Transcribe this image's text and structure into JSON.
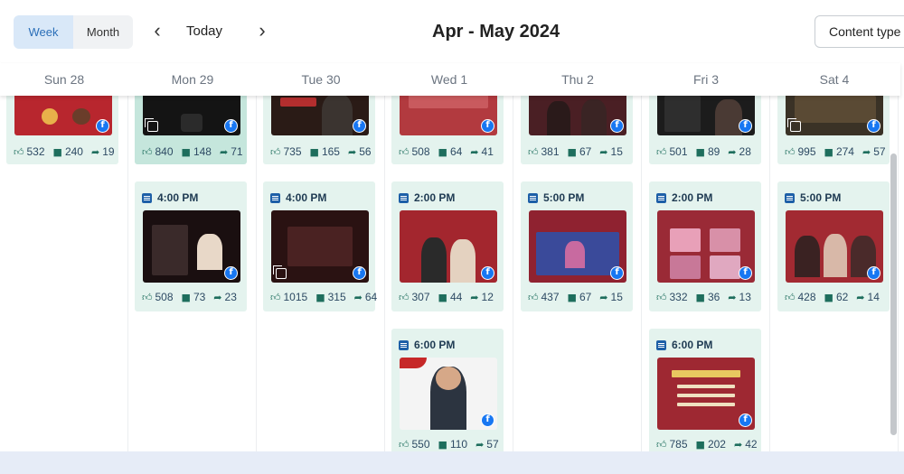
{
  "toolbar": {
    "view_week": "Week",
    "view_month": "Month",
    "today": "Today",
    "title": "Apr - May 2024",
    "content_type": "Content type",
    "prev_icon": "chevron-left-icon",
    "next_icon": "chevron-right-icon"
  },
  "days": [
    "Sun 28",
    "Mon 29",
    "Tue 30",
    "Wed 1",
    "Thu 2",
    "Fri 3",
    "Sat 4"
  ],
  "colors": {
    "accent": "#2b6fb8",
    "card": "#e4f3ee",
    "card_selected": "#c5e6dc",
    "facebook": "#1877f2"
  },
  "top_cards": [
    {
      "likes": "532",
      "comments": "240",
      "shares": "19"
    },
    {
      "likes": "840",
      "comments": "148",
      "shares": "71"
    },
    {
      "likes": "735",
      "comments": "165",
      "shares": "56"
    },
    {
      "likes": "508",
      "comments": "64",
      "shares": "41"
    },
    {
      "likes": "381",
      "comments": "67",
      "shares": "15"
    },
    {
      "likes": "501",
      "comments": "89",
      "shares": "28"
    },
    {
      "likes": "995",
      "comments": "274",
      "shares": "57"
    }
  ],
  "mid_cards": [
    {
      "time": "4:00 PM",
      "likes": "508",
      "comments": "73",
      "shares": "23"
    },
    {
      "time": "4:00 PM",
      "likes": "1015",
      "comments": "315",
      "shares": "64"
    },
    {
      "time": "2:00 PM",
      "likes": "307",
      "comments": "44",
      "shares": "12"
    },
    {
      "time": "5:00 PM",
      "likes": "437",
      "comments": "67",
      "shares": "15"
    },
    {
      "time": "2:00 PM",
      "likes": "332",
      "comments": "36",
      "shares": "13"
    },
    {
      "time": "5:00 PM",
      "likes": "428",
      "comments": "62",
      "shares": "14"
    }
  ],
  "late_cards": [
    {
      "time": "6:00 PM",
      "likes": "550",
      "comments": "110",
      "shares": "57"
    },
    {
      "time": "6:00 PM",
      "likes": "785",
      "comments": "202",
      "shares": "42"
    }
  ]
}
